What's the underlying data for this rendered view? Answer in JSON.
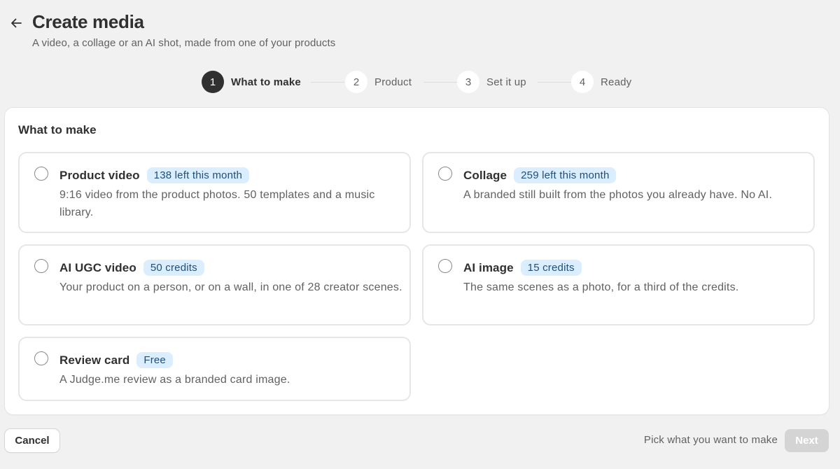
{
  "header": {
    "title": "Create media",
    "subtitle": "A video, a collage or an AI shot, made from one of your products",
    "back_icon": "arrow-left-icon"
  },
  "stepper": {
    "steps": [
      {
        "number": "1",
        "label": "What to make",
        "state": "active"
      },
      {
        "number": "2",
        "label": "Product",
        "state": "pending"
      },
      {
        "number": "3",
        "label": "Set it up",
        "state": "pending"
      },
      {
        "number": "4",
        "label": "Ready",
        "state": "pending"
      }
    ]
  },
  "section": {
    "title": "What to make",
    "options": [
      {
        "title": "Product video",
        "badge": "138 left this month",
        "description": "9:16 video from the product photos. 50 templates and a music library.",
        "selected": false
      },
      {
        "title": "Collage",
        "badge": "259 left this month",
        "description": "A branded still built from the photos you already have. No AI.",
        "selected": false
      },
      {
        "title": "AI UGC video",
        "badge": "50 credits",
        "description": "Your product on a person, or on a wall, in one of 28 creator scenes.",
        "selected": false
      },
      {
        "title": "AI image",
        "badge": "15 credits",
        "description": "The same scenes as a photo, for a third of the credits.",
        "selected": false
      },
      {
        "title": "Review card",
        "badge": "Free",
        "description": "A Judge.me review as a branded card image.",
        "selected": false
      }
    ]
  },
  "footer": {
    "cancel_label": "Cancel",
    "hint": "Pick what you want to make",
    "next_label": "Next",
    "next_disabled": true
  },
  "colors": {
    "badge_bg": "#dbeeff",
    "badge_text": "#1f4e79",
    "active_step": "#303030",
    "disabled_button": "#d4d4d4"
  }
}
